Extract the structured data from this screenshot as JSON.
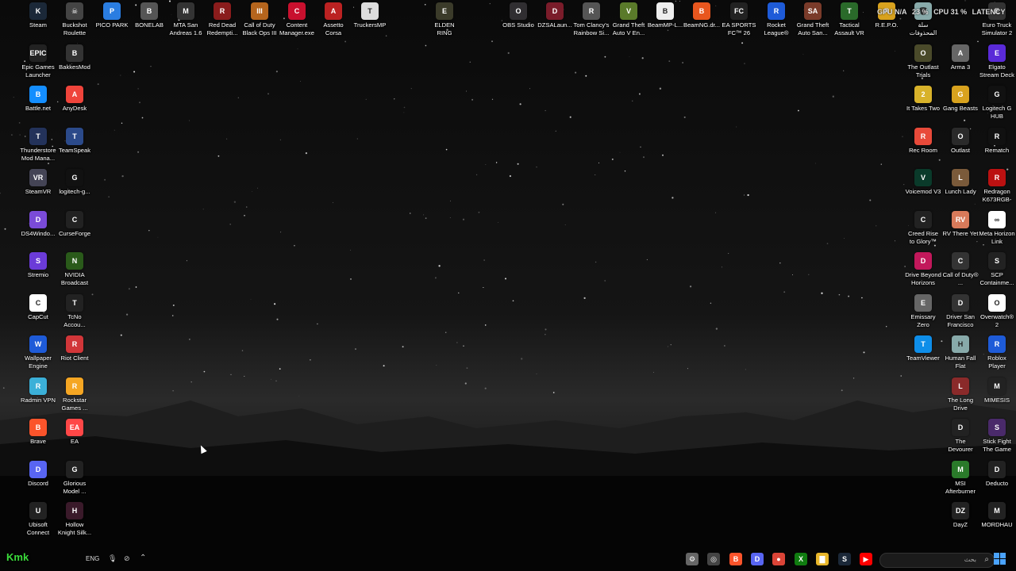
{
  "system_widget": {
    "gpu_label": "GPU N/A",
    "gpu_pct": "23 %",
    "cpu_label": "CPU 31 %",
    "lat_label": "LATENCY"
  },
  "taskbar": {
    "language": "ENG",
    "search_placeholder": "بحث",
    "watermark": "Kmk"
  },
  "desktop_icons": [
    {
      "label": "Steam",
      "color": "#1b2838",
      "glyph": "K"
    },
    {
      "label": "Buckshot Roulette",
      "color": "#444",
      "glyph": "☠"
    },
    {
      "label": "PICO PARK",
      "color": "#2a7de1",
      "glyph": "P"
    },
    {
      "label": "BONELAB",
      "color": "#555",
      "glyph": "B"
    },
    {
      "label": "MTA San Andreas 1.6",
      "color": "#333",
      "glyph": "M"
    },
    {
      "label": "Red Dead Redempti...",
      "color": "#8a1c1c",
      "glyph": "R"
    },
    {
      "label": "Call of Duty Black Ops III",
      "color": "#b5651d",
      "glyph": "III"
    },
    {
      "label": "Content Manager.exe",
      "color": "#c8102e",
      "glyph": "C"
    },
    {
      "label": "Assetto Corsa",
      "color": "#b22",
      "glyph": "A"
    },
    {
      "label": "TruckersMP",
      "color": "#ddd",
      "glyph": "T"
    },
    {
      "label": "ELDEN RING",
      "color": "#3b3b2a",
      "glyph": "E"
    },
    {
      "label": "OBS Studio",
      "color": "#302e31",
      "glyph": "O"
    },
    {
      "label": "DZSALaun...",
      "color": "#7a1c2a",
      "glyph": "D"
    },
    {
      "label": "Tom Clancy's Rainbow Si...",
      "color": "#555",
      "glyph": "R"
    },
    {
      "label": "Grand Theft Auto V En...",
      "color": "#5a7a2a",
      "glyph": "V"
    },
    {
      "label": "BeamMP-L...",
      "color": "#eee",
      "glyph": "B"
    },
    {
      "label": "BeamNG.dr...",
      "color": "#e8561e",
      "glyph": "B"
    },
    {
      "label": "EA SPORTS FC™ 26",
      "color": "#222",
      "glyph": "FC"
    },
    {
      "label": "Rocket League®",
      "color": "#1e5bd8",
      "glyph": "R"
    },
    {
      "label": "Grand Theft Auto San...",
      "color": "#7a3b2a",
      "glyph": "SA"
    },
    {
      "label": "Tactical Assault VR",
      "color": "#2a6a2a",
      "glyph": "T"
    },
    {
      "label": "R.E.P.O.",
      "color": "#d8a21e",
      "glyph": "R"
    },
    {
      "label": "سلة المحذوفات",
      "color": "#8aa",
      "glyph": "🗑"
    },
    {
      "label": "Euro Truck Simulator 2",
      "color": "#333",
      "glyph": "E"
    },
    {
      "label": "Epic Games Launcher",
      "color": "#222",
      "glyph": "EPIC"
    },
    {
      "label": "BakkesMod",
      "color": "#333",
      "glyph": "B"
    },
    {
      "label": "Battle.net",
      "color": "#148eff",
      "glyph": "B"
    },
    {
      "label": "AnyDesk",
      "color": "#ef443b",
      "glyph": "A"
    },
    {
      "label": "Thunderstore Mod Mana...",
      "color": "#23325a",
      "glyph": "T"
    },
    {
      "label": "TeamSpeak",
      "color": "#2b4a8a",
      "glyph": "T"
    },
    {
      "label": "SteamVR",
      "color": "#445",
      "glyph": "VR"
    },
    {
      "label": "logitech-g...",
      "color": "#111",
      "glyph": "G"
    },
    {
      "label": "DS4Windo...",
      "color": "#7a4bd8",
      "glyph": "D"
    },
    {
      "label": "CurseForge",
      "color": "#222",
      "glyph": "C"
    },
    {
      "label": "Stremio",
      "color": "#6b3bd8",
      "glyph": "S"
    },
    {
      "label": "NVIDIA Broadcast",
      "color": "#2a5a1a",
      "glyph": "N"
    },
    {
      "label": "CapCut",
      "color": "#fff",
      "glyph": "C"
    },
    {
      "label": "TcNo Accou...",
      "color": "#222",
      "glyph": "T"
    },
    {
      "label": "Wallpaper Engine",
      "color": "#1e5bd8",
      "glyph": "W"
    },
    {
      "label": "Riot Client",
      "color": "#d13639",
      "glyph": "R"
    },
    {
      "label": "Radmin VPN",
      "color": "#3bb0d8",
      "glyph": "R"
    },
    {
      "label": "Rockstar Games ...",
      "color": "#f5a623",
      "glyph": "R"
    },
    {
      "label": "Brave",
      "color": "#fb542b",
      "glyph": "B"
    },
    {
      "label": "EA",
      "color": "#ff4747",
      "glyph": "EA"
    },
    {
      "label": "Discord",
      "color": "#5865f2",
      "glyph": "D"
    },
    {
      "label": "Glorious Model ...",
      "color": "#222",
      "glyph": "G"
    },
    {
      "label": "Ubisoft Connect",
      "color": "#222",
      "glyph": "U"
    },
    {
      "label": "Hollow Knight Silk...",
      "color": "#3a1a2a",
      "glyph": "H"
    },
    {
      "label": "The Outlast Trials",
      "color": "#4a4a2a",
      "glyph": "O"
    },
    {
      "label": "Arma 3",
      "color": "#666",
      "glyph": "A"
    },
    {
      "label": "Elgato Stream Deck",
      "color": "#5a2ad8",
      "glyph": "E"
    },
    {
      "label": "It Takes Two",
      "color": "#d8b22a",
      "glyph": "2"
    },
    {
      "label": "Gang Beasts",
      "color": "#d8a21e",
      "glyph": "G"
    },
    {
      "label": "Logitech G HUB",
      "color": "#111",
      "glyph": "G"
    },
    {
      "label": "Rec Room",
      "color": "#e84a3a",
      "glyph": "R"
    },
    {
      "label": "Outlast",
      "color": "#2a2a2a",
      "glyph": "O"
    },
    {
      "label": "Rematch",
      "color": "#111",
      "glyph": "R"
    },
    {
      "label": "Voicemod V3",
      "color": "#0a3a2a",
      "glyph": "V"
    },
    {
      "label": "Lunch Lady",
      "color": "#7a5a3a",
      "glyph": "L"
    },
    {
      "label": "Redragon K673RGB-P...",
      "color": "#b11",
      "glyph": "R"
    },
    {
      "label": "Creed Rise to Glory™",
      "color": "#222",
      "glyph": "C"
    },
    {
      "label": "RV There Yet",
      "color": "#d87a5a",
      "glyph": "RV"
    },
    {
      "label": "Meta Horizon Link",
      "color": "#fff",
      "glyph": "∞"
    },
    {
      "label": "Drive Beyond Horizons",
      "color": "#c2185b",
      "glyph": "D"
    },
    {
      "label": "Call of Duty® ...",
      "color": "#333",
      "glyph": "C"
    },
    {
      "label": "SCP Containme...",
      "color": "#222",
      "glyph": "S"
    },
    {
      "label": "Emissary Zero",
      "color": "#666",
      "glyph": "E"
    },
    {
      "label": "Driver San Francisco",
      "color": "#333",
      "glyph": "D"
    },
    {
      "label": "Overwatch® 2",
      "color": "#fff",
      "glyph": "O"
    },
    {
      "label": "TeamViewer",
      "color": "#0e8ee9",
      "glyph": "T"
    },
    {
      "label": "Human Fall Flat",
      "color": "#8aa",
      "glyph": "H"
    },
    {
      "label": "Roblox Player",
      "color": "#1e5bd8",
      "glyph": "R"
    },
    {
      "label": "The Long Drive",
      "color": "#8a2a2a",
      "glyph": "L"
    },
    {
      "label": "MIMESIS",
      "color": "#222",
      "glyph": "M"
    },
    {
      "label": "The Devourer Hunted Souls",
      "color": "#222",
      "glyph": "D"
    },
    {
      "label": "Stick Fight The Game",
      "color": "#4a2a6a",
      "glyph": "S"
    },
    {
      "label": "MSI Afterburner",
      "color": "#2a7a2a",
      "glyph": "M"
    },
    {
      "label": "Deducto",
      "color": "#222",
      "glyph": "D"
    },
    {
      "label": "DayZ",
      "color": "#222",
      "glyph": "DZ"
    },
    {
      "label": "MORDHAU",
      "color": "#222",
      "glyph": "M"
    }
  ],
  "taskbar_apps": [
    {
      "name": "settings-app-icon",
      "glyph": "⚙",
      "color": "#666"
    },
    {
      "name": "steamvr-app-icon",
      "glyph": "◎",
      "color": "#444"
    },
    {
      "name": "brave-app-icon",
      "glyph": "B",
      "color": "#fb542b"
    },
    {
      "name": "discord-app-icon",
      "glyph": "D",
      "color": "#5865f2"
    },
    {
      "name": "chrome-app-icon",
      "glyph": "●",
      "color": "#db4437"
    },
    {
      "name": "xbox-app-icon",
      "glyph": "X",
      "color": "#107c10"
    },
    {
      "name": "file-explorer-app-icon",
      "glyph": "▇",
      "color": "#e8b62a"
    },
    {
      "name": "steam-app-icon",
      "glyph": "S",
      "color": "#1b2838"
    },
    {
      "name": "youtube-app-icon",
      "glyph": "▶",
      "color": "#f00"
    }
  ]
}
